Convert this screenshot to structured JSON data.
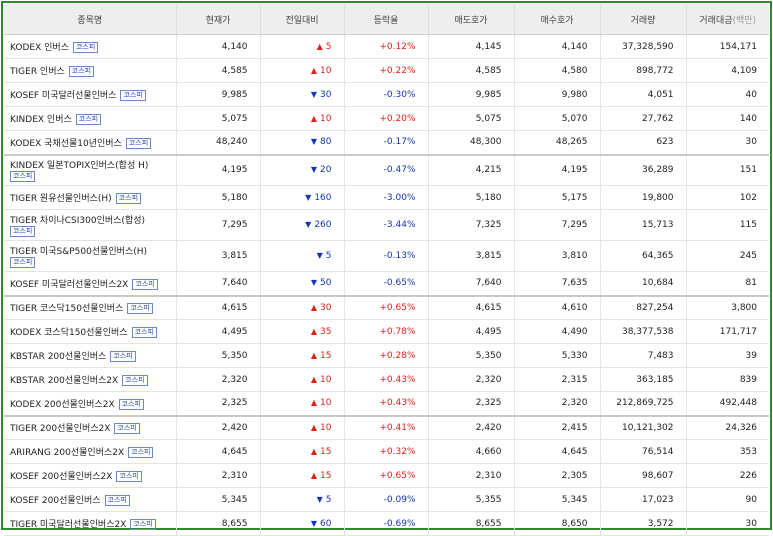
{
  "headers": {
    "name": "종목명",
    "price": "현재가",
    "change": "전일대비",
    "rate": "등락율",
    "ask": "매도호가",
    "bid": "매수호가",
    "volume": "거래량",
    "amount": "거래대금",
    "amount_unit": "(백만)"
  },
  "market_badge": "코스피",
  "colors": {
    "border": "#2f8a2f",
    "up": "#e0201a",
    "down": "#1436b4"
  },
  "rows": [
    {
      "name": "KODEX 인버스",
      "price": "4,140",
      "dir": "up",
      "arrow": "▲",
      "change": "5",
      "rate": "+0.12%",
      "ask": "4,145",
      "bid": "4,140",
      "volume": "37,328,590",
      "amount": "154,171"
    },
    {
      "name": "TIGER 인버스",
      "price": "4,585",
      "dir": "up",
      "arrow": "▲",
      "change": "10",
      "rate": "+0.22%",
      "ask": "4,585",
      "bid": "4,580",
      "volume": "898,772",
      "amount": "4,109"
    },
    {
      "name": "KOSEF 미국달러선물인버스",
      "price": "9,985",
      "dir": "down",
      "arrow": "▼",
      "change": "30",
      "rate": "-0.30%",
      "ask": "9,985",
      "bid": "9,980",
      "volume": "4,051",
      "amount": "40"
    },
    {
      "name": "KINDEX 인버스",
      "price": "5,075",
      "dir": "up",
      "arrow": "▲",
      "change": "10",
      "rate": "+0.20%",
      "ask": "5,075",
      "bid": "5,070",
      "volume": "27,762",
      "amount": "140"
    },
    {
      "name": "KODEX 국채선물10년인버스",
      "price": "48,240",
      "dir": "down",
      "arrow": "▼",
      "change": "80",
      "rate": "-0.17%",
      "ask": "48,300",
      "bid": "48,265",
      "volume": "623",
      "amount": "30"
    },
    {
      "name": "KINDEX 일본TOPIX인버스(합성 H)",
      "price": "4,195",
      "dir": "down",
      "arrow": "▼",
      "change": "20",
      "rate": "-0.47%",
      "ask": "4,215",
      "bid": "4,195",
      "volume": "36,289",
      "amount": "151"
    },
    {
      "name": "TIGER 원유선물인버스(H)",
      "price": "5,180",
      "dir": "down",
      "arrow": "▼",
      "change": "160",
      "rate": "-3.00%",
      "ask": "5,180",
      "bid": "5,175",
      "volume": "19,800",
      "amount": "102"
    },
    {
      "name": "TIGER 차이나CSI300인버스(합성)",
      "price": "7,295",
      "dir": "down",
      "arrow": "▼",
      "change": "260",
      "rate": "-3.44%",
      "ask": "7,325",
      "bid": "7,295",
      "volume": "15,713",
      "amount": "115"
    },
    {
      "name": "TIGER 미국S&P500선물인버스(H)",
      "price": "3,815",
      "dir": "down",
      "arrow": "▼",
      "change": "5",
      "rate": "-0.13%",
      "ask": "3,815",
      "bid": "3,810",
      "volume": "64,365",
      "amount": "245"
    },
    {
      "name": "KOSEF 미국달러선물인버스2X",
      "price": "7,640",
      "dir": "down",
      "arrow": "▼",
      "change": "50",
      "rate": "-0.65%",
      "ask": "7,640",
      "bid": "7,635",
      "volume": "10,684",
      "amount": "81"
    },
    {
      "name": "TIGER 코스닥150선물인버스",
      "price": "4,615",
      "dir": "up",
      "arrow": "▲",
      "change": "30",
      "rate": "+0.65%",
      "ask": "4,615",
      "bid": "4,610",
      "volume": "827,254",
      "amount": "3,800"
    },
    {
      "name": "KODEX 코스닥150선물인버스",
      "price": "4,495",
      "dir": "up",
      "arrow": "▲",
      "change": "35",
      "rate": "+0.78%",
      "ask": "4,495",
      "bid": "4,490",
      "volume": "38,377,538",
      "amount": "171,717"
    },
    {
      "name": "KBSTAR 200선물인버스",
      "price": "5,350",
      "dir": "up",
      "arrow": "▲",
      "change": "15",
      "rate": "+0.28%",
      "ask": "5,350",
      "bid": "5,330",
      "volume": "7,483",
      "amount": "39"
    },
    {
      "name": "KBSTAR 200선물인버스2X",
      "price": "2,320",
      "dir": "up",
      "arrow": "▲",
      "change": "10",
      "rate": "+0.43%",
      "ask": "2,320",
      "bid": "2,315",
      "volume": "363,185",
      "amount": "839"
    },
    {
      "name": "KODEX 200선물인버스2X",
      "price": "2,325",
      "dir": "up",
      "arrow": "▲",
      "change": "10",
      "rate": "+0.43%",
      "ask": "2,325",
      "bid": "2,320",
      "volume": "212,869,725",
      "amount": "492,448"
    },
    {
      "name": "TIGER 200선물인버스2X",
      "price": "2,420",
      "dir": "up",
      "arrow": "▲",
      "change": "10",
      "rate": "+0.41%",
      "ask": "2,420",
      "bid": "2,415",
      "volume": "10,121,302",
      "amount": "24,326"
    },
    {
      "name": "ARIRANG 200선물인버스2X",
      "price": "4,645",
      "dir": "up",
      "arrow": "▲",
      "change": "15",
      "rate": "+0.32%",
      "ask": "4,660",
      "bid": "4,645",
      "volume": "76,514",
      "amount": "353"
    },
    {
      "name": "KOSEF 200선물인버스2X",
      "price": "2,310",
      "dir": "up",
      "arrow": "▲",
      "change": "15",
      "rate": "+0.65%",
      "ask": "2,310",
      "bid": "2,305",
      "volume": "98,607",
      "amount": "226"
    },
    {
      "name": "KOSEF 200선물인버스",
      "price": "5,345",
      "dir": "down",
      "arrow": "▼",
      "change": "5",
      "rate": "-0.09%",
      "ask": "5,355",
      "bid": "5,345",
      "volume": "17,023",
      "amount": "90"
    },
    {
      "name": "TIGER 미국달러선물인버스2X",
      "price": "8,655",
      "dir": "down",
      "arrow": "▼",
      "change": "60",
      "rate": "-0.69%",
      "ask": "8,655",
      "bid": "8,650",
      "volume": "3,572",
      "amount": "30"
    }
  ]
}
